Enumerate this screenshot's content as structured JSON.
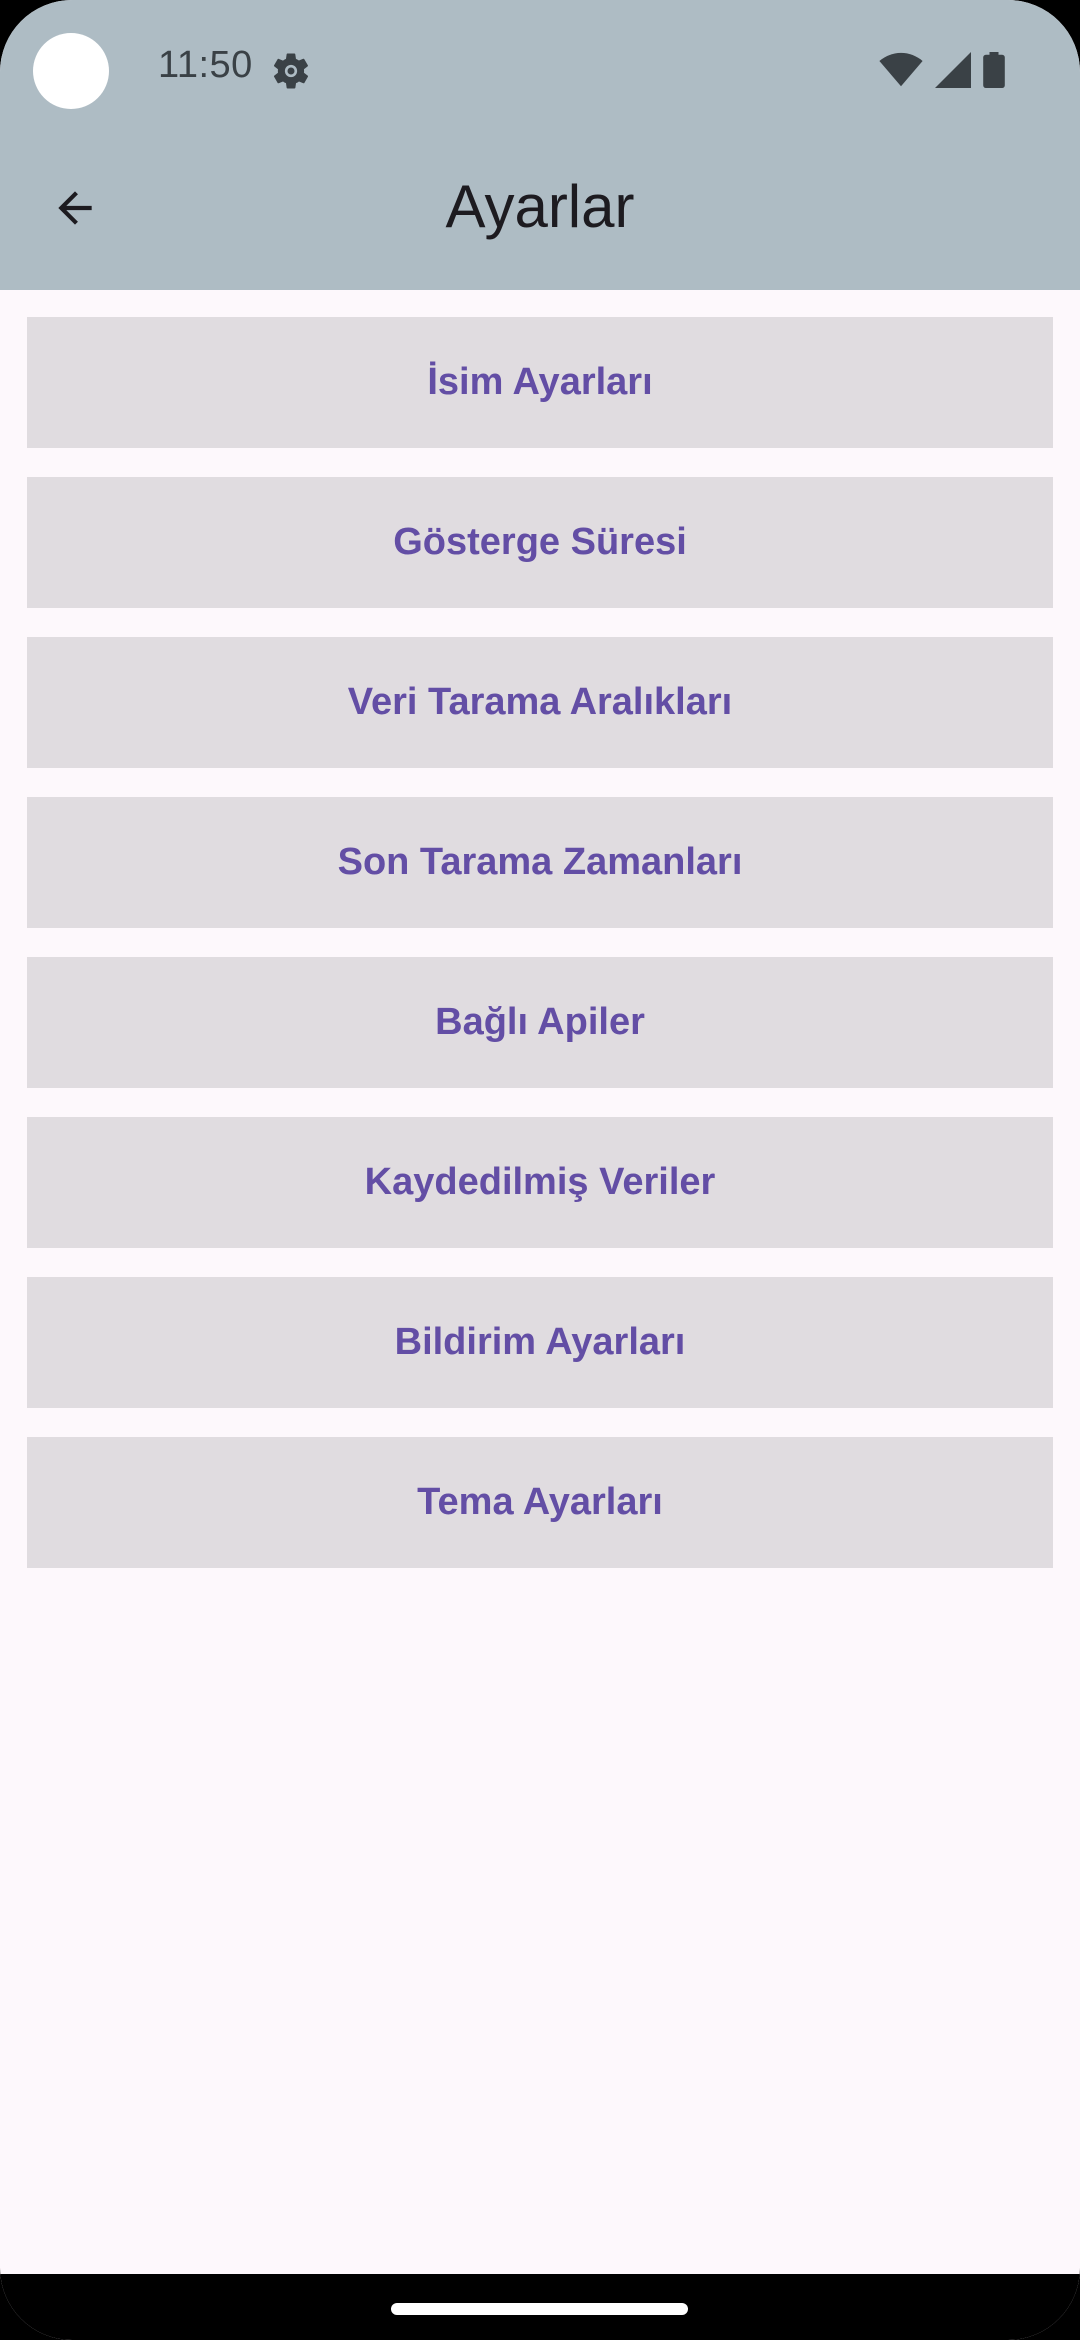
{
  "status_bar": {
    "time": "11:50",
    "icons": [
      "settings-gear-icon",
      "wifi-icon",
      "cellular-signal-icon",
      "battery-icon"
    ]
  },
  "app_bar": {
    "title": "Ayarlar",
    "back_icon": "arrow-back-icon"
  },
  "menu": {
    "items": [
      {
        "label": "İsim Ayarları"
      },
      {
        "label": "Gösterge Süresi"
      },
      {
        "label": "Veri Tarama Aralıkları"
      },
      {
        "label": "Son Tarama Zamanları"
      },
      {
        "label": "Bağlı Apiler"
      },
      {
        "label": "Kaydedilmiş Veriler"
      },
      {
        "label": "Bildirim Ayarları"
      },
      {
        "label": "Tema Ayarları"
      }
    ]
  },
  "colors": {
    "app_bar_background": "#aebcc4",
    "page_background": "#fdf8fc",
    "button_background": "#e0dce0",
    "button_text": "#634ea5"
  }
}
